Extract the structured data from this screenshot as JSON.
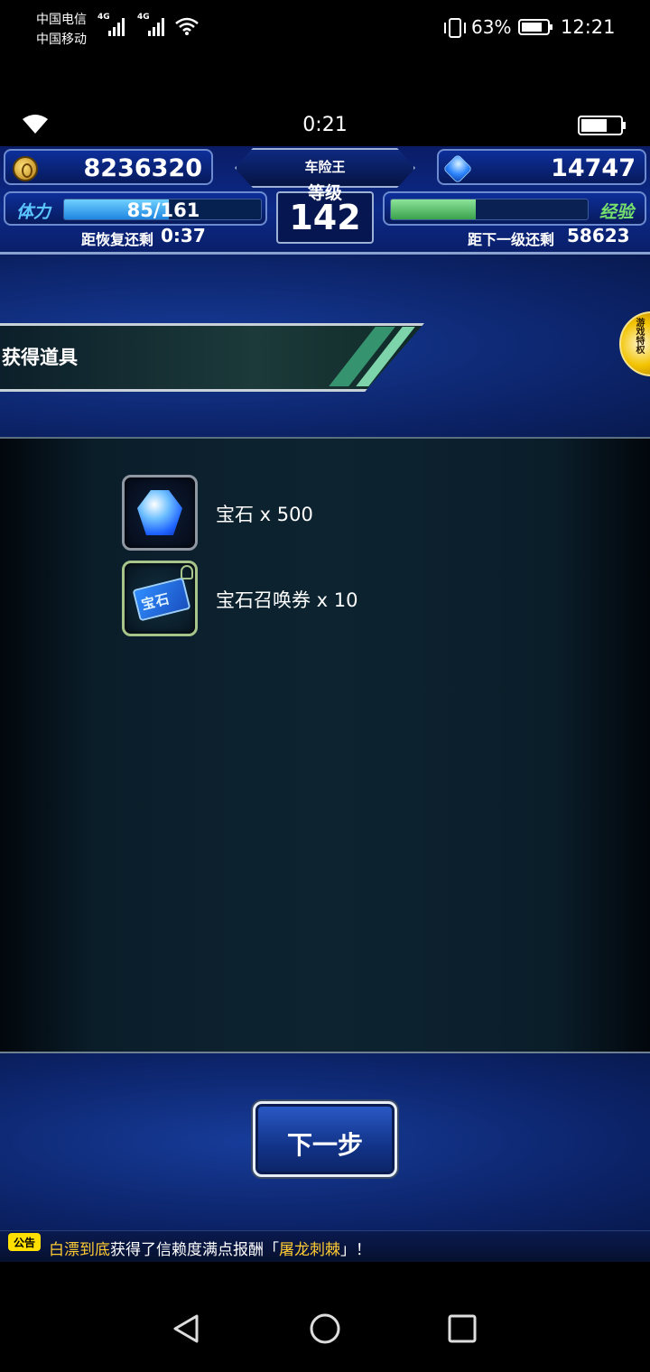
{
  "status_bar": {
    "carrier_1": "中国电信",
    "carrier_2": "中国移动",
    "net_1": "4G",
    "net_2": "4G",
    "battery_percent": "63%",
    "time": "12:21"
  },
  "game_bar": {
    "time": "0:21"
  },
  "hud": {
    "gil": "8236320",
    "gems": "14747",
    "player_name": "车险王",
    "level_label": "等级",
    "level": "142",
    "stamina_label": "体力",
    "stamina_value": "85/161",
    "stamina_fraction": 0.53,
    "recover_label": "距恢复还剩",
    "recover_time": "0:37",
    "exp_label": "经验",
    "exp_fraction": 0.43,
    "next_level_label": "距下一级还剩",
    "next_level_value": "58623"
  },
  "banner": {
    "title": "获得道具",
    "side_tab": "游戏特权"
  },
  "items": [
    {
      "icon": "gem-icon",
      "label": "宝石 x 500"
    },
    {
      "icon": "summon-ticket-icon",
      "label": "宝石召唤券 x 10",
      "ticket_text": "宝石"
    }
  ],
  "next_button": {
    "label": "下一步"
  },
  "ticker": {
    "badge": "公告",
    "player": "白漂到底",
    "text_a": "获得了信赖度满点报酬「",
    "reward": "屠龙刺棘",
    "text_b": "」！"
  },
  "nav_bar": {
    "icons": [
      "back-icon",
      "home-icon",
      "recents-icon"
    ]
  },
  "colors": {
    "hud_blue": "#0c2a88",
    "panel_dark": "#0d2430",
    "stamina_blue": "#5cc7ff",
    "exp_green": "#78e06c",
    "highlight_yellow": "#ffcc33"
  }
}
